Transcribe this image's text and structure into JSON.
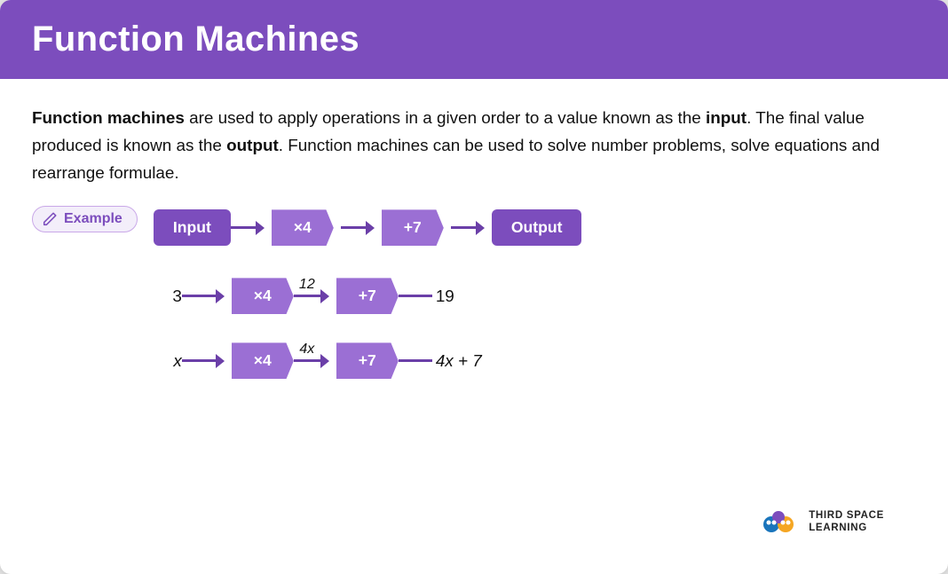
{
  "header": {
    "title": "Function Machines",
    "bg": "#7c4dbd"
  },
  "description": {
    "part1": "Function machines",
    "part2": " are used to apply operations in a given order to a value known as the ",
    "part3": "input",
    "part4": ". The final value produced is known as the ",
    "part5": "output",
    "part6": ". Function machines can be used to solve number problems, solve equations and rearrange formulae."
  },
  "example_badge": {
    "label": "Example"
  },
  "diagram": {
    "row1": {
      "input": "Input",
      "op1": "×4",
      "op2": "+7",
      "output": "Output"
    },
    "row2": {
      "input": "3",
      "op1": "×4",
      "intermediate": "12",
      "op2": "+7",
      "output": "19"
    },
    "row3": {
      "input": "x",
      "op1": "×4",
      "intermediate": "4x",
      "op2": "+7",
      "output": "4x + 7"
    }
  },
  "logo": {
    "line1": "THIRD SPACE",
    "line2": "LEARNING"
  }
}
